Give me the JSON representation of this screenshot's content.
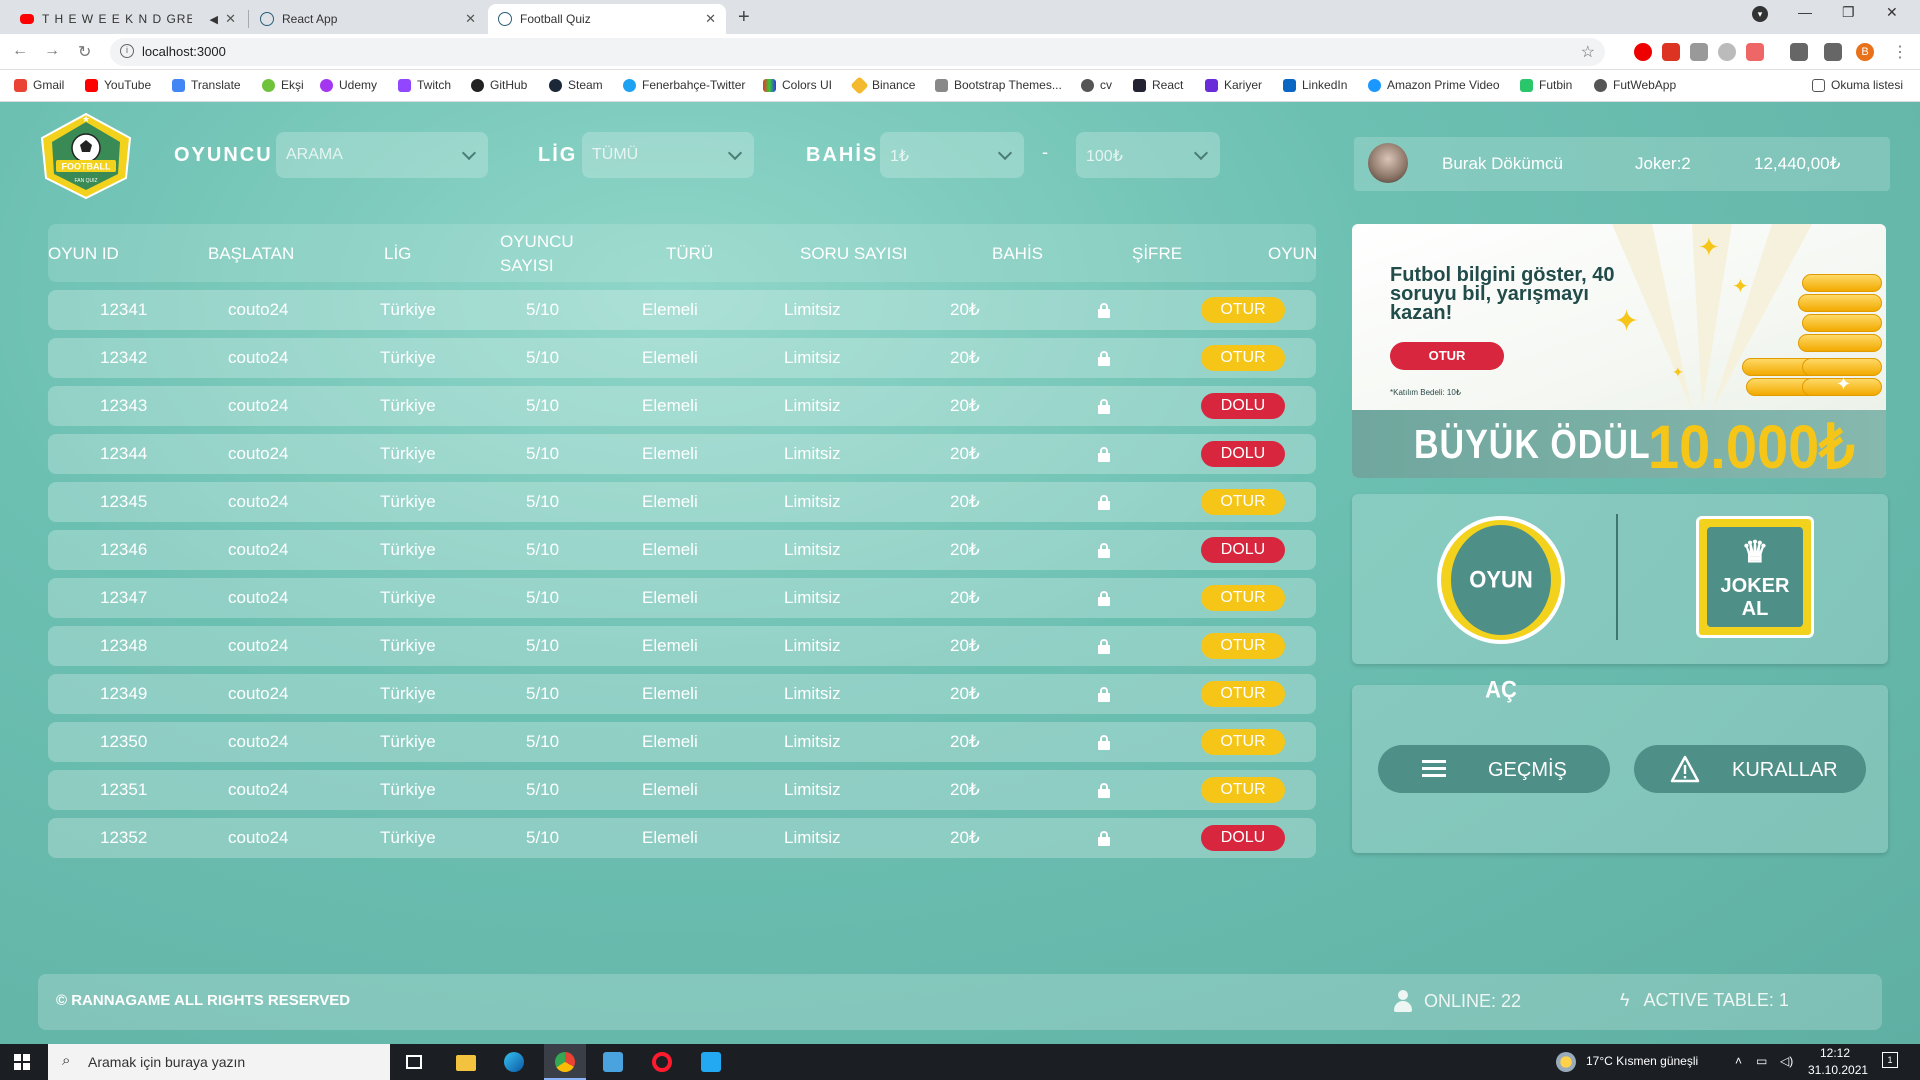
{
  "browser": {
    "tabs": [
      {
        "title": "T H E W E E K N D GREATEST"
      },
      {
        "title": "React App"
      },
      {
        "title": "Football Quiz"
      }
    ],
    "url": "localhost:3000",
    "profile_initial": "B",
    "bookmarks": [
      "Gmail",
      "YouTube",
      "Translate",
      "Ekşi",
      "Udemy",
      "Twitch",
      "GitHub",
      "Steam",
      "Fenerbahçe-Twitter",
      "Colors UI",
      "Binance",
      "Bootstrap Themes...",
      "cv",
      "React",
      "Kariyer",
      "LinkedIn",
      "Amazon Prime Video",
      "Futbin",
      "FutWebApp"
    ],
    "reading_list": "Okuma listesi"
  },
  "app": {
    "logo_text": "FOOTBALL",
    "logo_sub": "FAN QUIZ",
    "filters": {
      "player_label": "OYUNCU",
      "player_value": "ARAMA",
      "league_label": "LİG",
      "league_value": "TÜMÜ",
      "bet_label": "BAHİS",
      "bet_min": "1₺",
      "bet_sep": "-",
      "bet_max": "100₺"
    },
    "user": {
      "name": "Burak Dökümcü",
      "joker": "Joker:2",
      "balance": "12,440,00₺"
    },
    "table": {
      "headers": [
        "OYUN ID",
        "BAŞLATAN",
        "LİG",
        "OYUNCU SAYISI",
        "TÜRÜ",
        "SORU SAYISI",
        "BAHİS",
        "ŞİFRE",
        "OYUN"
      ],
      "rows": [
        {
          "id": "12341",
          "starter": "couto24",
          "league": "Türkiye",
          "players": "5/10",
          "type": "Elemeli",
          "questions": "Limitsiz",
          "bet": "20₺",
          "status": "OTUR"
        },
        {
          "id": "12342",
          "starter": "couto24",
          "league": "Türkiye",
          "players": "5/10",
          "type": "Elemeli",
          "questions": "Limitsiz",
          "bet": "20₺",
          "status": "OTUR"
        },
        {
          "id": "12343",
          "starter": "couto24",
          "league": "Türkiye",
          "players": "5/10",
          "type": "Elemeli",
          "questions": "Limitsiz",
          "bet": "20₺",
          "status": "DOLU"
        },
        {
          "id": "12344",
          "starter": "couto24",
          "league": "Türkiye",
          "players": "5/10",
          "type": "Elemeli",
          "questions": "Limitsiz",
          "bet": "20₺",
          "status": "DOLU"
        },
        {
          "id": "12345",
          "starter": "couto24",
          "league": "Türkiye",
          "players": "5/10",
          "type": "Elemeli",
          "questions": "Limitsiz",
          "bet": "20₺",
          "status": "OTUR"
        },
        {
          "id": "12346",
          "starter": "couto24",
          "league": "Türkiye",
          "players": "5/10",
          "type": "Elemeli",
          "questions": "Limitsiz",
          "bet": "20₺",
          "status": "DOLU"
        },
        {
          "id": "12347",
          "starter": "couto24",
          "league": "Türkiye",
          "players": "5/10",
          "type": "Elemeli",
          "questions": "Limitsiz",
          "bet": "20₺",
          "status": "OTUR"
        },
        {
          "id": "12348",
          "starter": "couto24",
          "league": "Türkiye",
          "players": "5/10",
          "type": "Elemeli",
          "questions": "Limitsiz",
          "bet": "20₺",
          "status": "OTUR"
        },
        {
          "id": "12349",
          "starter": "couto24",
          "league": "Türkiye",
          "players": "5/10",
          "type": "Elemeli",
          "questions": "Limitsiz",
          "bet": "20₺",
          "status": "OTUR"
        },
        {
          "id": "12350",
          "starter": "couto24",
          "league": "Türkiye",
          "players": "5/10",
          "type": "Elemeli",
          "questions": "Limitsiz",
          "bet": "20₺",
          "status": "OTUR"
        },
        {
          "id": "12351",
          "starter": "couto24",
          "league": "Türkiye",
          "players": "5/10",
          "type": "Elemeli",
          "questions": "Limitsiz",
          "bet": "20₺",
          "status": "OTUR"
        },
        {
          "id": "12352",
          "starter": "couto24",
          "league": "Türkiye",
          "players": "5/10",
          "type": "Elemeli",
          "questions": "Limitsiz",
          "bet": "20₺",
          "status": "DOLU"
        }
      ]
    },
    "banner": {
      "headline": "Futbol bilgini göster, 40 soruyu bil, yarışmayı kazan!",
      "button": "OTUR",
      "fee": "*Katılım Bedeli: 10₺",
      "prize_label": "BÜYÜK ÖDÜL",
      "prize_amount": "10.000₺"
    },
    "actions": {
      "open_game": "OYUN AÇ",
      "buy_joker": "JOKER AL"
    },
    "nav": {
      "history": "GEÇMİŞ",
      "rules": "KURALLAR"
    },
    "footer": {
      "copyright": "© RANNAGAME ALL RIGHTS RESERVED",
      "online": "ONLINE: 22",
      "active_table": "ACTIVE TABLE: 1"
    }
  },
  "taskbar": {
    "search_placeholder": "Aramak için buraya yazın",
    "weather": "17°C  Kısmen güneşli",
    "time": "12:12",
    "date": "31.10.2021",
    "notif_count": "1"
  },
  "colors": {
    "accent": "#6bbfb1",
    "otur": "#f5c518",
    "dolu": "#d7263d",
    "button_teal": "#4e8f87"
  }
}
